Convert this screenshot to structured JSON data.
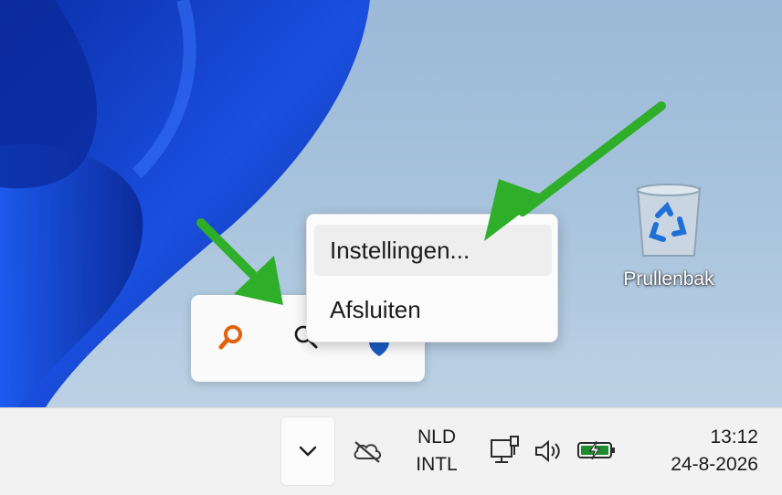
{
  "context_menu": {
    "items": [
      "Instellingen...",
      "Afsluiten"
    ]
  },
  "desktop": {
    "recycle_bin_label": "Prullenbak"
  },
  "tray_overflow": {
    "icons": [
      "everything-search-icon",
      "search-icon",
      "defender-shield-icon"
    ]
  },
  "taskbar": {
    "language_line1": "NLD",
    "language_line2": "INTL",
    "time": "13:12",
    "date": "24-8-2026"
  },
  "colors": {
    "annotation_arrow": "#2fae2a",
    "wallpaper_blue": "#1240c8",
    "taskbar": "#f2f2f2"
  }
}
